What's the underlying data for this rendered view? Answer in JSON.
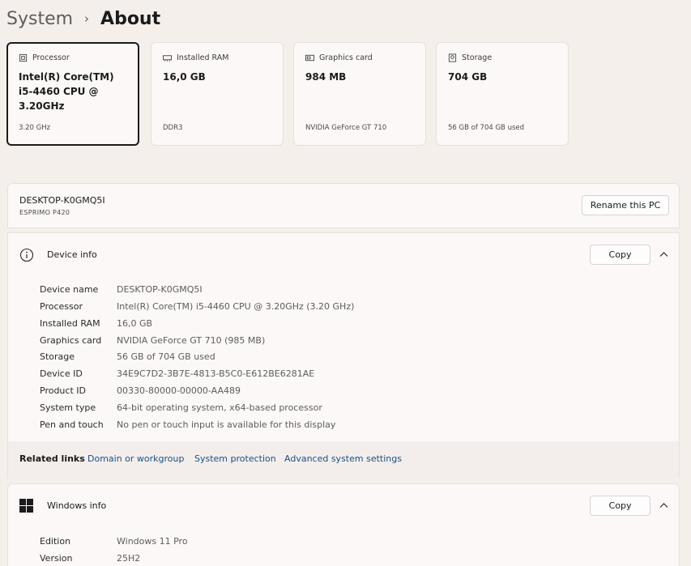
{
  "breadcrumb": {
    "parent": "System",
    "separator": "›",
    "current": "About"
  },
  "cards": [
    {
      "title": "Processor",
      "value": "Intel(R) Core(TM) i5-4460  CPU @ 3.20GHz",
      "sub": "3.20 GHz",
      "icon": "processor-icon"
    },
    {
      "title": "Installed RAM",
      "value": "16,0 GB",
      "sub": "DDR3",
      "icon": "ram-icon"
    },
    {
      "title": "Graphics card",
      "value": "984 MB",
      "sub": "NVIDIA GeForce GT 710",
      "icon": "graphics-card-icon"
    },
    {
      "title": "Storage",
      "value": "704 GB",
      "sub": "56 GB of 704 GB used",
      "icon": "storage-icon"
    }
  ],
  "pc": {
    "name": "DESKTOP-K0GMQ5I",
    "model": "ESPRIMO P420",
    "rename_label": "Rename this PC"
  },
  "device_info": {
    "title": "Device info",
    "copy_label": "Copy",
    "specs": [
      {
        "label": "Device name",
        "value": "DESKTOP-K0GMQ5I"
      },
      {
        "label": "Processor",
        "value": "Intel(R) Core(TM) i5-4460 CPU @ 3.20GHz (3.20 GHz)"
      },
      {
        "label": "Installed RAM",
        "value": "16,0 GB"
      },
      {
        "label": "Graphics card",
        "value": "NVIDIA GeForce GT 710 (985 MB)"
      },
      {
        "label": "Storage",
        "value": "56 GB of 704 GB used"
      },
      {
        "label": "Device ID",
        "value": "34E9C7D2-3B7E-4813-B5C0-E612BE6281AE"
      },
      {
        "label": "Product ID",
        "value": "00330-80000-00000-AA489"
      },
      {
        "label": "System type",
        "value": "64-bit operating system, x64-based processor"
      },
      {
        "label": "Pen and touch",
        "value": "No pen or touch input is available for this display"
      }
    ]
  },
  "related": {
    "title": "Related links",
    "links": [
      "Domain or workgroup",
      "System protection",
      "Advanced system settings"
    ]
  },
  "windows_info": {
    "title": "Windows info",
    "copy_label": "Copy",
    "specs": [
      {
        "label": "Edition",
        "value": "Windows 11 Pro"
      },
      {
        "label": "Version",
        "value": "25H2"
      }
    ]
  },
  "colors": {
    "link": "#1a4f8b",
    "windows_logo": "#1b1b1b",
    "background": "#f5efec"
  }
}
